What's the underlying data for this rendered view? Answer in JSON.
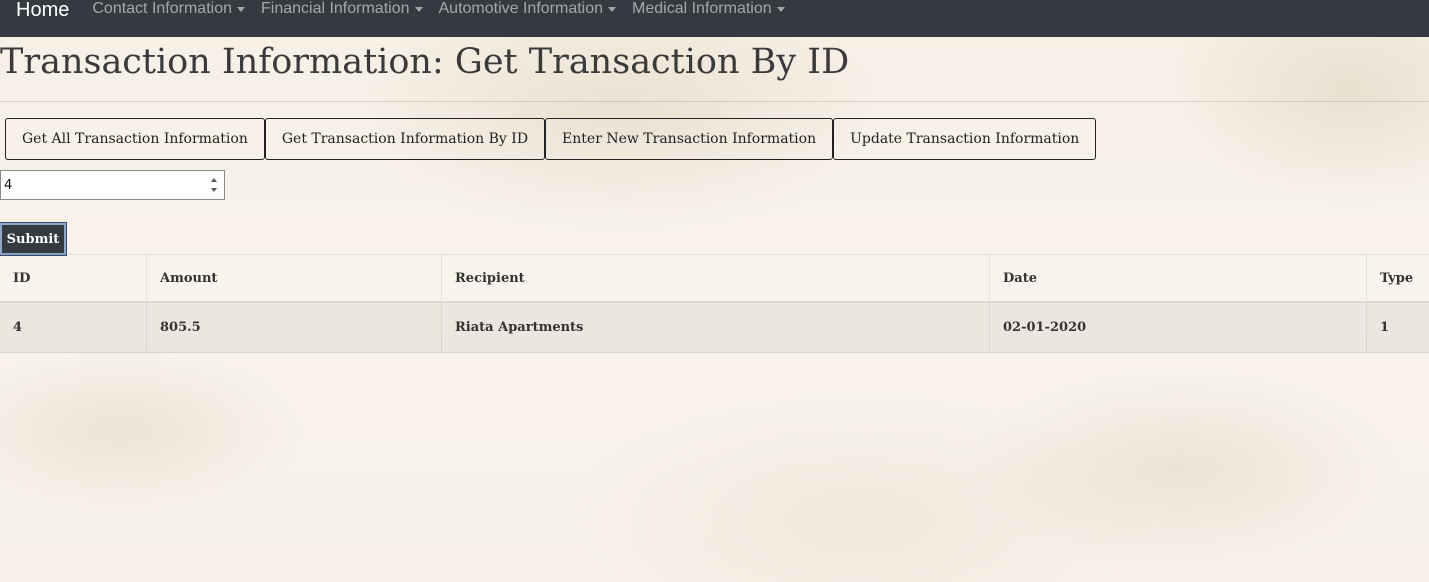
{
  "navbar": {
    "brand": "Home",
    "menus": [
      {
        "label": "Contact Information"
      },
      {
        "label": "Financial Information"
      },
      {
        "label": "Automotive Information"
      },
      {
        "label": "Medical Information"
      }
    ]
  },
  "page": {
    "title": "Transaction Information: Get Transaction By ID"
  },
  "actions": [
    {
      "label": "Get All Transaction Information"
    },
    {
      "label": "Get Transaction Information By ID"
    },
    {
      "label": "Enter New Transaction Information"
    },
    {
      "label": "Update Transaction Information"
    }
  ],
  "form": {
    "id_value": "4",
    "submit_label": "Submit"
  },
  "table": {
    "headers": [
      "ID",
      "Amount",
      "Recipient",
      "Date",
      "Type"
    ],
    "rows": [
      [
        "4",
        "805.5",
        "Riata Apartments",
        "02-01-2020",
        "1"
      ]
    ]
  },
  "colors": {
    "navbar_bg": "#343a40",
    "submit_bg": "#343a40"
  }
}
